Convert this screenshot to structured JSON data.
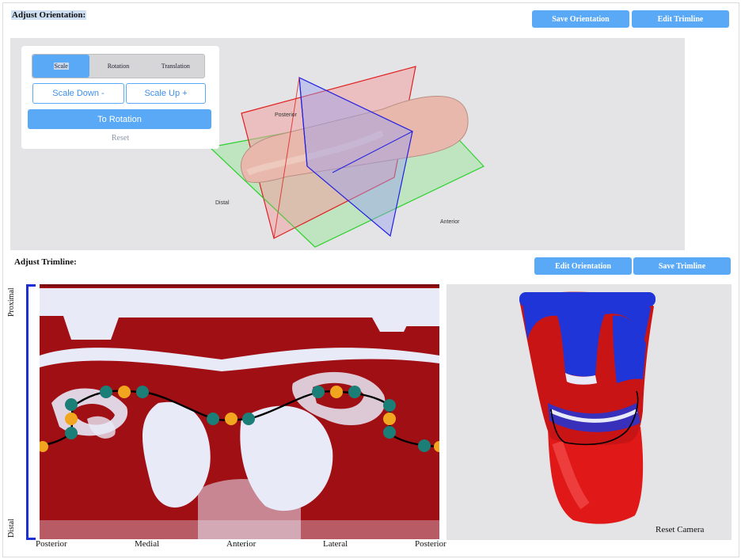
{
  "orientation": {
    "title": "Adjust Orientation:",
    "save_label": "Save Orientation",
    "edit_trimline_label": "Edit Trimline",
    "tabs": [
      "Scale",
      "Rotation",
      "Translation"
    ],
    "scale_down_label": "Scale Down -",
    "scale_up_label": "Scale Up +",
    "to_rotation_label": "To Rotation",
    "reset_label": "Reset",
    "viewport_labels": {
      "posterior": "Posterior",
      "distal": "Distal",
      "anterior": "Anterior"
    }
  },
  "trimline": {
    "title": "Adjust Trimline:",
    "edit_orientation_label": "Edit Orientation",
    "save_trimline_label": "Save Trimline",
    "y_axis": {
      "top": "Proximal",
      "bottom": "Distal"
    },
    "x_axis": [
      "Posterior",
      "Medial",
      "Anterior",
      "Lateral",
      "Posterior"
    ],
    "reset_camera_label": "Reset Camera"
  },
  "colors": {
    "accent": "#5aa9f7",
    "heat_high": "#a00f14",
    "heat_low": "#e8eaf8",
    "control_point": "#1b7f78",
    "handle_point": "#f2a51f",
    "scale_blue": "#1c2fd6"
  }
}
